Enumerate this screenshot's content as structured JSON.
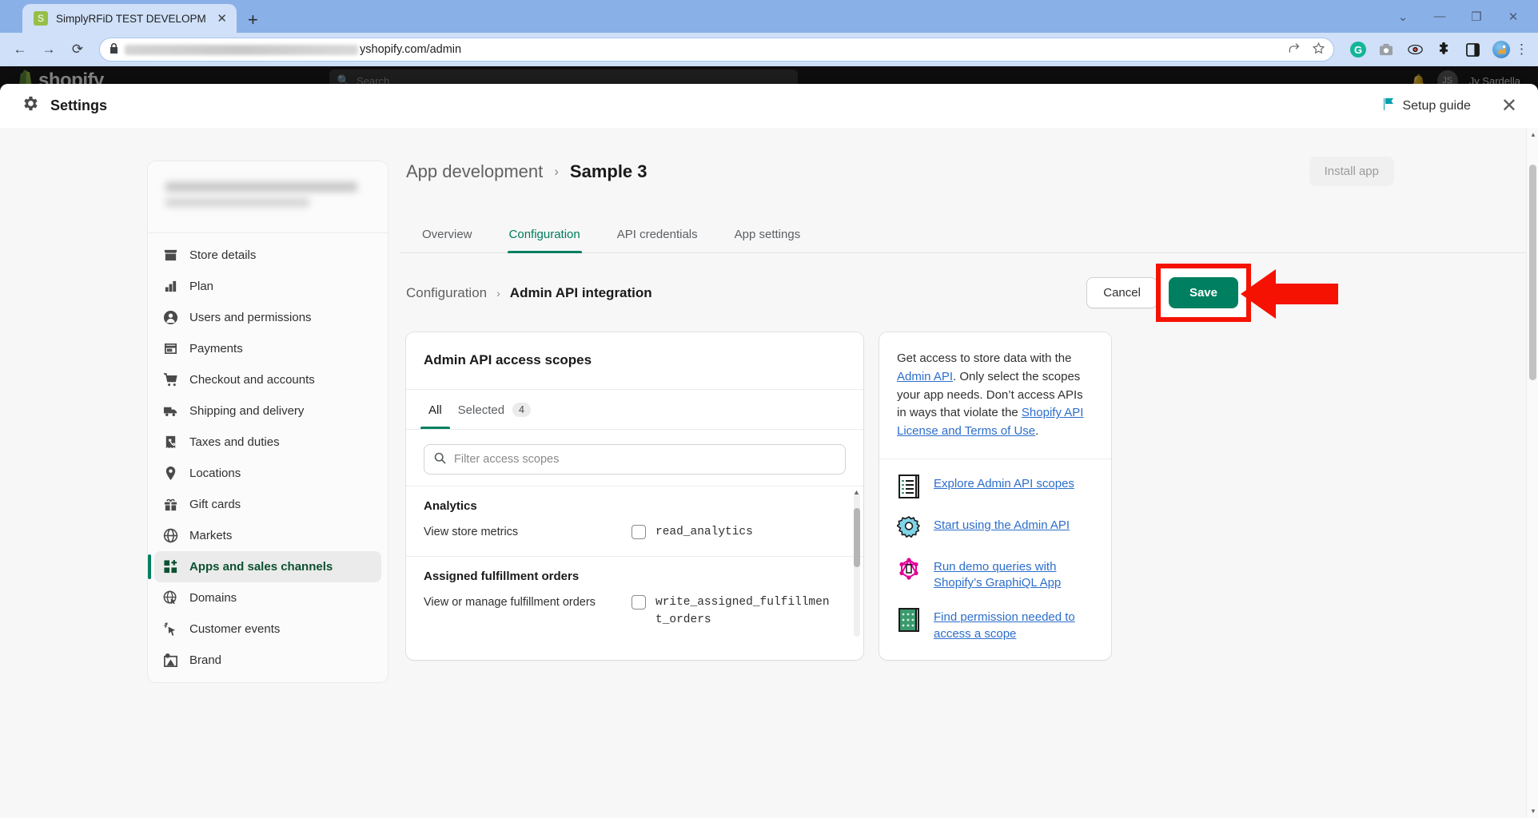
{
  "browser": {
    "tab_title": "SimplyRFiD TEST DEVELOPMENT",
    "tab_close": "✕",
    "new_tab": "+",
    "window_buttons": [
      "⌄",
      "—",
      "❐",
      "✕"
    ],
    "nav": {
      "back": "←",
      "forward": "→",
      "reload": "⟳"
    },
    "url_visible": "yshopify.com/admin",
    "lock_icon": "🔒",
    "omnibox_actions": [
      "share-icon",
      "bookmark-star-icon"
    ],
    "extensions": [
      "grammarly-icon",
      "screenshot-icon",
      "eye-icon",
      "puzzle-icon",
      "sidepanel-icon",
      "profile-avatar"
    ],
    "menu": "⋮"
  },
  "shopify_bar": {
    "brand": "shopify",
    "search_placeholder": "Search",
    "user_initials": "JS",
    "user_name": "Jy Sardella"
  },
  "modal": {
    "title": "Settings",
    "setup_guide": "Setup guide",
    "close": "✕"
  },
  "sidebar": {
    "items": [
      {
        "label": "Store details",
        "icon": "store-icon",
        "active": false
      },
      {
        "label": "Plan",
        "icon": "plan-icon",
        "active": false
      },
      {
        "label": "Users and permissions",
        "icon": "user-icon",
        "active": false
      },
      {
        "label": "Payments",
        "icon": "payments-icon",
        "active": false
      },
      {
        "label": "Checkout and accounts",
        "icon": "cart-icon",
        "active": false
      },
      {
        "label": "Shipping and delivery",
        "icon": "truck-icon",
        "active": false
      },
      {
        "label": "Taxes and duties",
        "icon": "receipt-percent-icon",
        "active": false
      },
      {
        "label": "Locations",
        "icon": "pin-icon",
        "active": false
      },
      {
        "label": "Gift cards",
        "icon": "gift-icon",
        "active": false
      },
      {
        "label": "Markets",
        "icon": "globe-icon",
        "active": false
      },
      {
        "label": "Apps and sales channels",
        "icon": "apps-icon",
        "active": true
      },
      {
        "label": "Domains",
        "icon": "domain-globe-icon",
        "active": false
      },
      {
        "label": "Customer events",
        "icon": "cursor-sparkle-icon",
        "active": false
      },
      {
        "label": "Brand",
        "icon": "brand-icon",
        "active": false
      }
    ]
  },
  "main": {
    "breadcrumb": {
      "parent": "App development",
      "separator": "›",
      "current": "Sample 3"
    },
    "install_button": "Install app",
    "tabs": [
      {
        "label": "Overview",
        "active": false
      },
      {
        "label": "Configuration",
        "active": true
      },
      {
        "label": "API credentials",
        "active": false
      },
      {
        "label": "App settings",
        "active": false
      }
    ],
    "sub_breadcrumb": {
      "parent": "Configuration",
      "separator": "›",
      "current": "Admin API integration"
    },
    "cancel_button": "Cancel",
    "save_button": "Save",
    "annotation": {
      "highlight_color": "#f51202",
      "arrow_color": "#f51202",
      "points_to": "save-button"
    }
  },
  "scopes_card": {
    "title": "Admin API access scopes",
    "tabs": [
      {
        "label": "All",
        "active": true,
        "count": null
      },
      {
        "label": "Selected",
        "active": false,
        "count": "4"
      }
    ],
    "filter_placeholder": "Filter access scopes",
    "filter_value": "",
    "groups": [
      {
        "title": "Analytics",
        "rows": [
          {
            "description": "View store metrics",
            "scope": "read_analytics",
            "checked": false
          }
        ]
      },
      {
        "title": "Assigned fulfillment orders",
        "rows": [
          {
            "description": "View or manage fulfillment orders",
            "scope": "write_assigned_fulfillment_orders",
            "checked": false
          }
        ]
      }
    ]
  },
  "help_card": {
    "paragraph_parts": {
      "t1": "Get access to store data with the ",
      "l1": "Admin API",
      "t2": ". Only select the scopes your app needs. Don’t access APIs in ways that violate the ",
      "l2": "Shopify API License and Terms of Use",
      "t3": "."
    },
    "links": [
      {
        "label": "Explore Admin API scopes",
        "icon": "scroll-list-icon"
      },
      {
        "label": "Start using the Admin API",
        "icon": "blue-gear-icon"
      },
      {
        "label": "Run demo queries with Shopify’s GraphiQL App",
        "icon": "graphql-icon"
      },
      {
        "label": "Find permission needed to access a scope",
        "icon": "green-scroll-icon"
      }
    ]
  },
  "colors": {
    "shopify_green": "#008060",
    "accent_link": "#2c6ecb",
    "annotation_red": "#f51202",
    "teal_flag": "#00a0ac"
  }
}
